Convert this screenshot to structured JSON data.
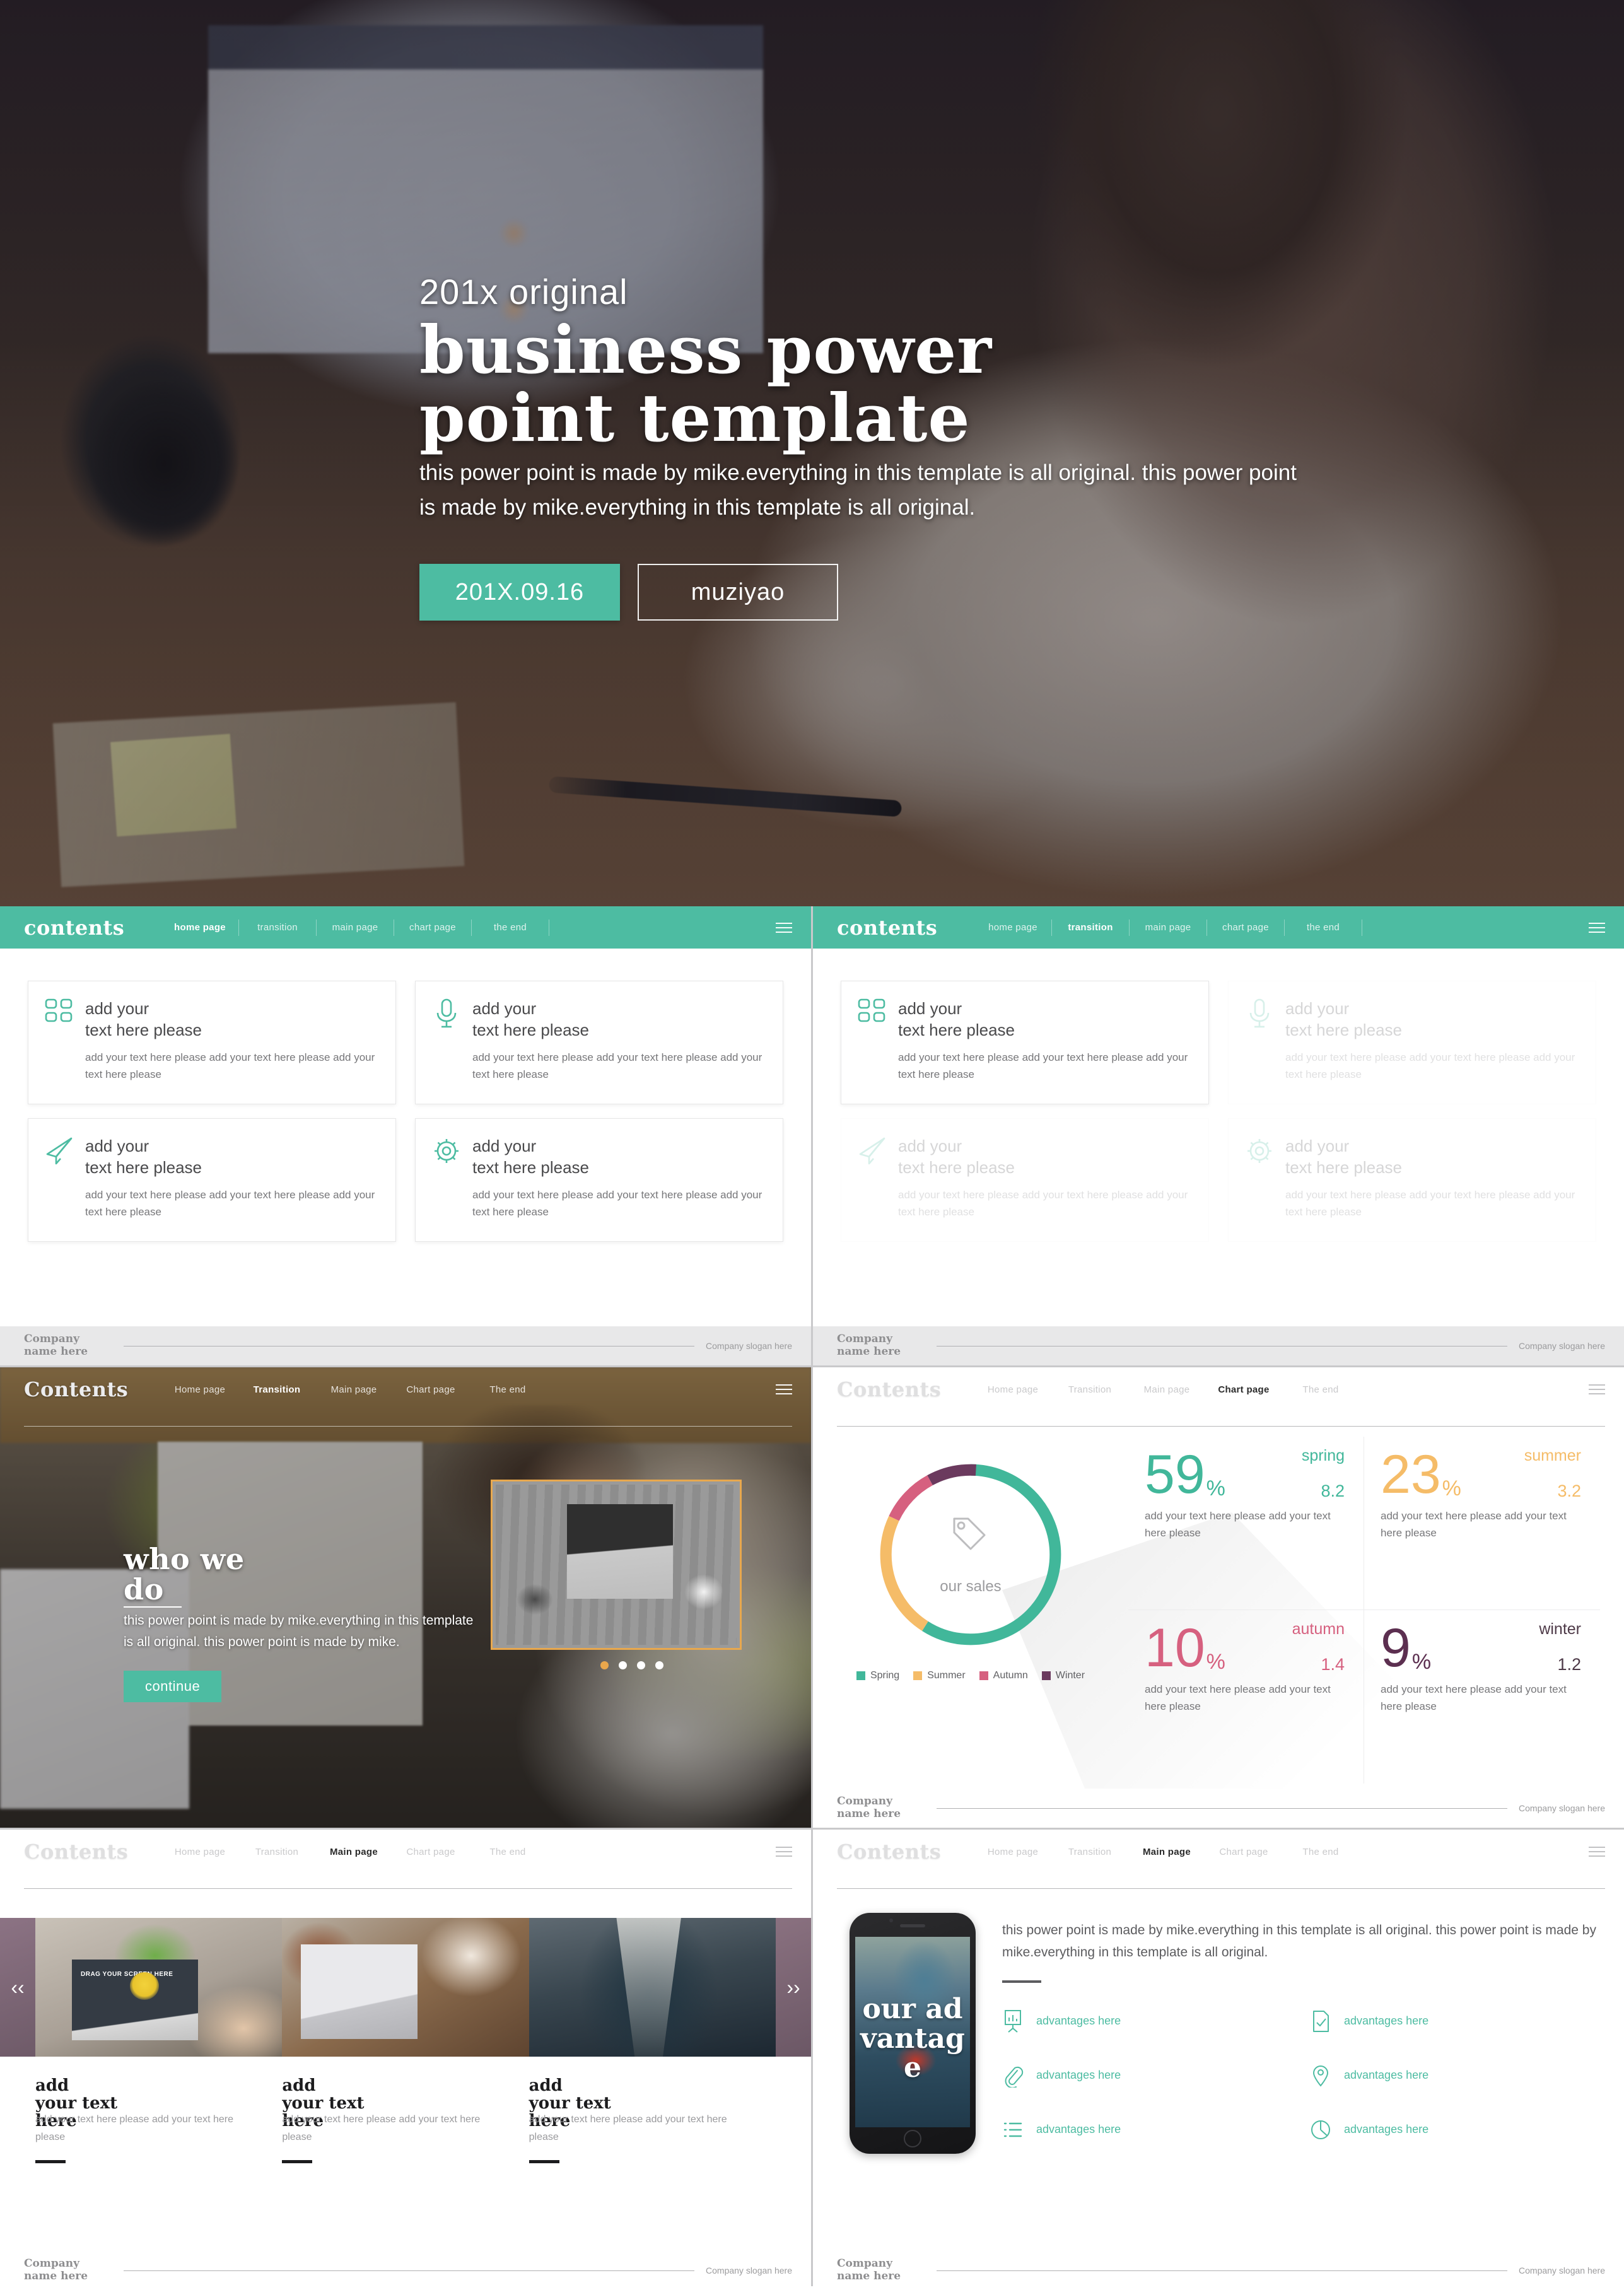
{
  "hero": {
    "eyebrow": "201x original",
    "title_line1": "business power",
    "title_line2": "point template",
    "subtitle": "this power point is made by mike.everything in this template is all original. this power point is made by mike.everything in this template is all original.",
    "date_button": "201X.09.16",
    "author_button": "muziyao"
  },
  "nav_lower": {
    "title": "contents",
    "items": [
      "home page",
      "transition",
      "main page",
      "chart page",
      "the end"
    ],
    "menu_icon": "hamburger-icon"
  },
  "nav_upper": {
    "title": "Contents",
    "items": [
      "Home page",
      "Transition",
      "Main page",
      "Chart page",
      "The end"
    ],
    "menu_icon": "hamburger-icon"
  },
  "footer": {
    "name_line1": "Company",
    "name_line2": "name here",
    "slogan": "Company slogan here"
  },
  "content_slide": {
    "active_nav": "home page",
    "cards": [
      {
        "icon": "grid-squares-icon",
        "title_line1": "add your",
        "title_line2": "text here please",
        "body": "add your text here please add your text here please add your text here please"
      },
      {
        "icon": "microphone-icon",
        "title_line1": "add your",
        "title_line2": "text here please",
        "body": "add your text here please add your text here please add your text here please"
      },
      {
        "icon": "paper-plane-icon",
        "title_line1": "add your",
        "title_line2": "text here please",
        "body": "add your text here please add your text here please add your text here please"
      },
      {
        "icon": "gear-icon",
        "title_line1": "add your",
        "title_line2": "text here please",
        "body": "add your text here please add your text here please add your text here please"
      }
    ]
  },
  "content_slide_2": {
    "active_nav": "transition"
  },
  "transition_slide": {
    "active_nav": "Transition",
    "heading_line1": "who we",
    "heading_line2": "do",
    "body": "this power point is made by mike.everything in this template is all original. this power point is made by mike.",
    "cta": "continue",
    "carousel_dots": 4,
    "active_dot": 1
  },
  "chart_slide": {
    "active_nav": "Chart page",
    "donut_label": "our sales",
    "center_icon": "price-tag-icon"
  },
  "chart_data": {
    "type": "pie",
    "title": "our sales",
    "categories": [
      "Spring",
      "Summer",
      "Autumn",
      "Winter"
    ],
    "values": [
      59,
      23,
      10,
      9
    ],
    "secondary_values": [
      8.2,
      3.2,
      1.4,
      1.2
    ],
    "unit": "%",
    "colors": [
      "#41b79a",
      "#f5bc68",
      "#d6607f",
      "#6b3a5e"
    ],
    "legend": [
      "Spring",
      "Summer",
      "Autumn",
      "Winter"
    ],
    "legend_position": "bottom",
    "descriptions": [
      "add your text here please add your text here please",
      "add your text here please add your text here please",
      "add your text here please add your text here please",
      "add your text here please add your text here please"
    ],
    "season_labels": [
      "spring",
      "summer",
      "autumn",
      "winter"
    ]
  },
  "gallery_slide": {
    "active_nav": "Main page",
    "prev_icon": "chevron-left-icon",
    "next_icon": "chevron-right-icon",
    "photo1_caption": "DRAG YOUR SCREEN HERE",
    "columns": [
      {
        "h1": "add",
        "h2": "your text",
        "h3": "here",
        "body": "add your text here please add your text here please"
      },
      {
        "h1": "add",
        "h2": "your text",
        "h3": "here",
        "body": "add your text here please add your text here please"
      },
      {
        "h1": "add",
        "h2": "your text",
        "h3": "here",
        "body": "add your text here please add your text here please"
      }
    ]
  },
  "phone_slide": {
    "active_nav": "Main page",
    "phone_title": "our advantage",
    "lead": "this power point is made by mike.everything in this template is all original. this power point is made by mike.everything in this template is all original.",
    "advantages": [
      {
        "icon": "presentation-chart-icon",
        "label": "advantages here"
      },
      {
        "icon": "document-check-icon",
        "label": "advantages here"
      },
      {
        "icon": "paperclip-icon",
        "label": "advantages here"
      },
      {
        "icon": "location-pin-icon",
        "label": "advantages here"
      },
      {
        "icon": "list-icon",
        "label": "advantages here"
      },
      {
        "icon": "pie-chart-icon",
        "label": "advantages here"
      }
    ]
  },
  "colors": {
    "accent_teal": "#4dbca2",
    "orange": "#f5bc68",
    "pink": "#d6607f",
    "purple": "#6b3a5e",
    "dot_active": "#e9a74c",
    "thumb_border": "#e8a84e"
  }
}
